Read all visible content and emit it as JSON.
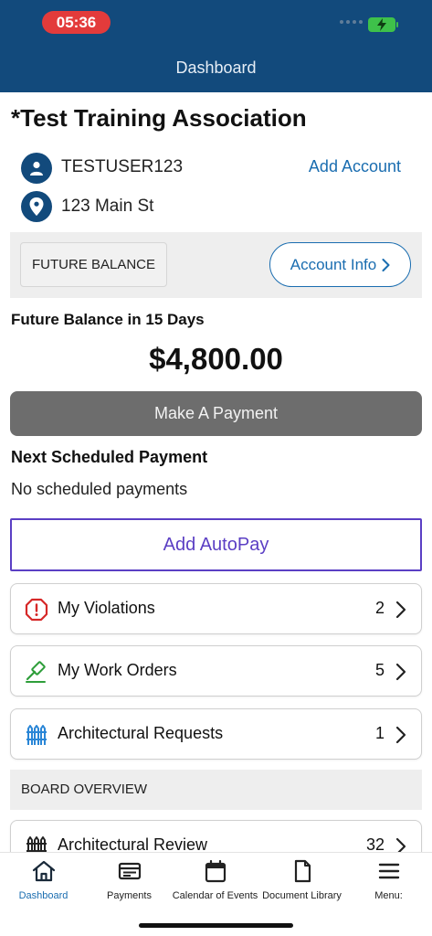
{
  "status_bar": {
    "time": "05:36"
  },
  "header": {
    "title": "Dashboard"
  },
  "org": {
    "name": "*Test Training Association"
  },
  "account": {
    "username": "TESTUSER123",
    "address": "123 Main St",
    "add_account_label": "Add Account"
  },
  "balance": {
    "future_label": "FUTURE BALANCE",
    "account_info_label": "Account Info",
    "future_days_label": "Future Balance in 15 Days",
    "amount": "$4,800.00",
    "pay_button_label": "Make A Payment"
  },
  "scheduled": {
    "title": "Next Scheduled Payment",
    "empty_text": "No scheduled payments"
  },
  "autopay": {
    "label": "Add AutoPay"
  },
  "items": [
    {
      "label": "My Violations",
      "count": "2",
      "icon": "alert-octagon-icon"
    },
    {
      "label": "My Work Orders",
      "count": "5",
      "icon": "gavel-icon"
    },
    {
      "label": "Architectural Requests",
      "count": "1",
      "icon": "fence-icon"
    }
  ],
  "board_overview": {
    "title": "BOARD OVERVIEW",
    "items": [
      {
        "label": "Architectural Review",
        "count": "32",
        "icon": "fence-icon"
      }
    ]
  },
  "tabbar": {
    "tabs": [
      {
        "label": "Dashboard",
        "icon": "home-icon",
        "active": true
      },
      {
        "label": "Payments",
        "icon": "payments-icon",
        "active": false
      },
      {
        "label": "Calendar of Events",
        "icon": "calendar-icon",
        "active": false
      },
      {
        "label": "Document Library",
        "icon": "document-icon",
        "active": false
      },
      {
        "label": "Menu:",
        "icon": "menu-icon",
        "active": false
      }
    ]
  },
  "colors": {
    "header_bg": "#124a7c",
    "accent_blue": "#1a6db0",
    "autopay_purple": "#5b3fc4",
    "pay_button_gray": "#6d6d6d",
    "violation_red": "#d62828",
    "work_order_green": "#2e9e3a",
    "fence_blue": "#2a86d6"
  }
}
